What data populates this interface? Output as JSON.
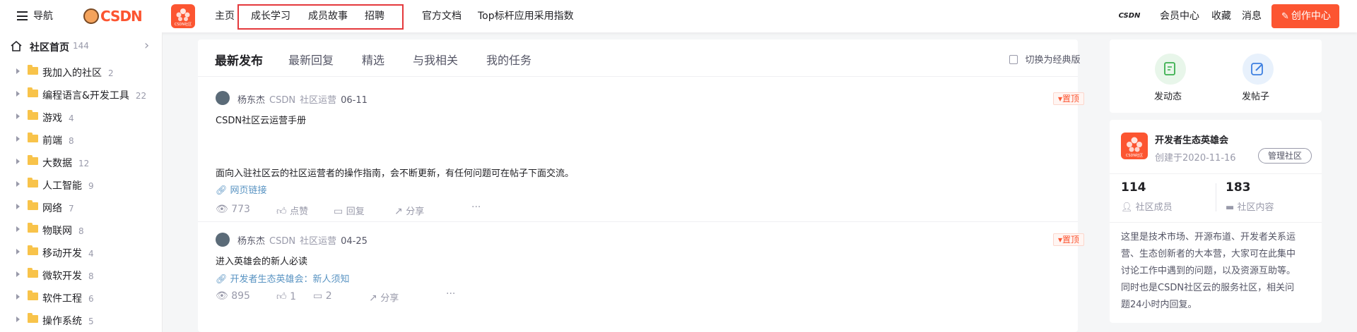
{
  "topnav": {
    "menu_label": "导航",
    "logo_text": "CSDN",
    "community_badge": "CSDN社区",
    "links": [
      "主页",
      "成长学习",
      "成员故事",
      "招聘",
      "官方文档",
      "Top标杆应用采用指数"
    ],
    "avatar_text": "CSDN",
    "right_links": [
      "会员中心",
      "收藏",
      "消息"
    ],
    "create_label": "创作中心",
    "accent": "#fc5531",
    "highlight_box_color": "#e4393c"
  },
  "sidebar": {
    "home": {
      "label": "社区首页",
      "count": "144"
    },
    "items": [
      {
        "label": "我加入的社区",
        "count": "2"
      },
      {
        "label": "编程语言&开发工具",
        "count": "22"
      },
      {
        "label": "游戏",
        "count": "4"
      },
      {
        "label": "前端",
        "count": "8"
      },
      {
        "label": "大数据",
        "count": "12"
      },
      {
        "label": "人工智能",
        "count": "9"
      },
      {
        "label": "网络",
        "count": "7"
      },
      {
        "label": "物联网",
        "count": "8"
      },
      {
        "label": "移动开发",
        "count": "4"
      },
      {
        "label": "微软开发",
        "count": "8"
      },
      {
        "label": "软件工程",
        "count": "6"
      },
      {
        "label": "操作系统",
        "count": "5"
      }
    ]
  },
  "main": {
    "tabs": [
      "最新发布",
      "最新回复",
      "精选",
      "与我相关",
      "我的任务"
    ],
    "switch_label": "切换为经典版",
    "posts": [
      {
        "author": "杨东杰",
        "org": "CSDN",
        "role": "社区运营",
        "date": "06-11",
        "pin": "置顶",
        "title": "CSDN社区云运营手册",
        "body": "面向入驻社区云的社区运营者的操作指南，会不断更新，有任何问题可在帖子下面交流。",
        "link": "网页链接",
        "views": "773",
        "like": "点赞",
        "reply": "回复",
        "share": "分享",
        "more": "···"
      },
      {
        "author": "杨东杰",
        "org": "CSDN",
        "role": "社区运营",
        "date": "04-25",
        "pin": "置顶",
        "title": "进入英雄会的新人必读",
        "link": "开发者生态英雄会：新人须知",
        "views": "895",
        "like": "1",
        "reply": "2",
        "share": "分享",
        "more": "···"
      }
    ]
  },
  "right": {
    "actions": [
      {
        "label": "发动态",
        "color": "#e8f6ea",
        "icon": "post-dynamic-icon"
      },
      {
        "label": "发帖子",
        "color": "#e8f1fc",
        "icon": "edit-post-icon"
      }
    ],
    "community": {
      "name": "开发者生态英雄会",
      "created": "创建于2020-11-16",
      "manage_label": "管理社区",
      "logo_text": "CSDN社区",
      "members": "114",
      "members_label": "社区成员",
      "contents": "183",
      "contents_label": "社区内容",
      "description": [
        "这里是技术市场、开源布道、开发者关系运",
        "营、生态创新者的大本营，大家可在此集中",
        "讨论工作中遇到的问题，以及资源互助等。",
        "同时也是CSDN社区云的服务社区，相关问",
        "题24小时内回复。"
      ]
    }
  }
}
